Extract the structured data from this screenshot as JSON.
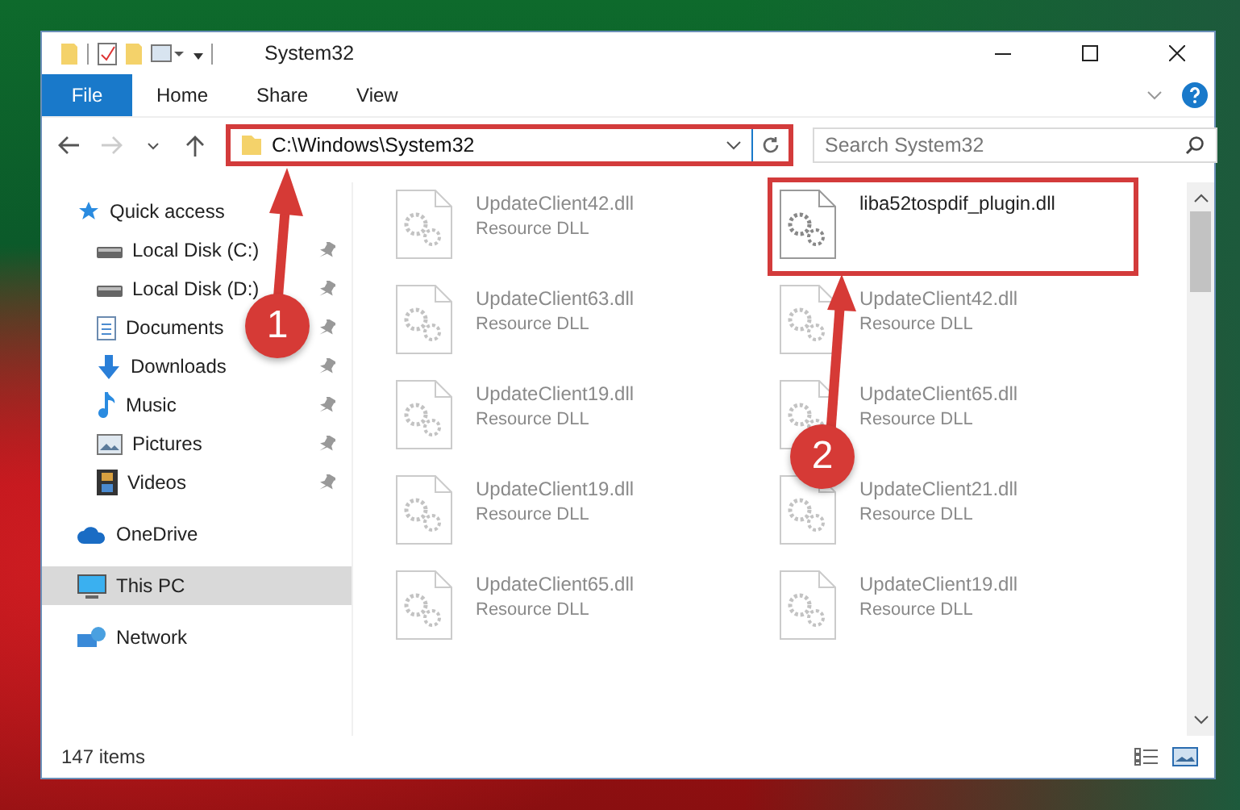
{
  "window": {
    "title": "System32"
  },
  "ribbon": {
    "tabs": [
      {
        "label": "File",
        "kind": "file",
        "selected": false
      },
      {
        "label": "Home",
        "kind": "tab",
        "selected": false
      },
      {
        "label": "Share",
        "kind": "tab",
        "selected": false
      },
      {
        "label": "View",
        "kind": "tab",
        "selected": false
      }
    ]
  },
  "address": {
    "path": "C:\\Windows\\System32",
    "highlighted": true
  },
  "search": {
    "placeholder": "Search System32"
  },
  "sidebar": {
    "items": [
      {
        "label": "Quick access",
        "selected": false,
        "children": [
          {
            "label": "Local Disk (C:)",
            "selected": false
          },
          {
            "label": "Local Disk (D:)",
            "selected": false
          },
          {
            "label": "Documents",
            "selected": false
          },
          {
            "label": "Downloads",
            "selected": false
          },
          {
            "label": "Music",
            "selected": false
          },
          {
            "label": "Pictures",
            "selected": false
          },
          {
            "label": "Videos",
            "selected": false
          }
        ]
      },
      {
        "label": "OneDrive",
        "selected": false
      },
      {
        "label": "This PC",
        "selected": true
      },
      {
        "label": "Network",
        "selected": false
      }
    ]
  },
  "files": [
    {
      "name": "UpdateClient42.dll",
      "type": "Resource DLL",
      "blurred": true,
      "highlighted": false
    },
    {
      "name": "UpdateClient63.dll",
      "type": "Resource DLL",
      "blurred": true,
      "highlighted": false
    },
    {
      "name": "UpdateClient19.dll",
      "type": "Resource DLL",
      "blurred": true,
      "highlighted": false
    },
    {
      "name": "UpdateClient19.dll",
      "type": "Resource DLL",
      "blurred": true,
      "highlighted": false
    },
    {
      "name": "UpdateClient65.dll",
      "type": "Resource DLL",
      "blurred": true,
      "highlighted": false
    },
    {
      "name": "liba52tospdif_plugin.dll",
      "blurred": false,
      "highlighted": true
    },
    {
      "name": "UpdateClient42.dll",
      "type": "Resource DLL",
      "blurred": true,
      "highlighted": false
    },
    {
      "name": "UpdateClient65.dll",
      "type": "Resource DLL",
      "blurred": true,
      "highlighted": false
    },
    {
      "name": "UpdateClient21.dll",
      "type": "Resource DLL",
      "blurred": true,
      "highlighted": false
    },
    {
      "name": "UpdateClient19.dll",
      "type": "Resource DLL",
      "blurred": true,
      "highlighted": false
    }
  ],
  "status_bar": {
    "count": "147 items"
  },
  "annotations": [
    {
      "number": "1"
    },
    {
      "number": "2"
    }
  ]
}
